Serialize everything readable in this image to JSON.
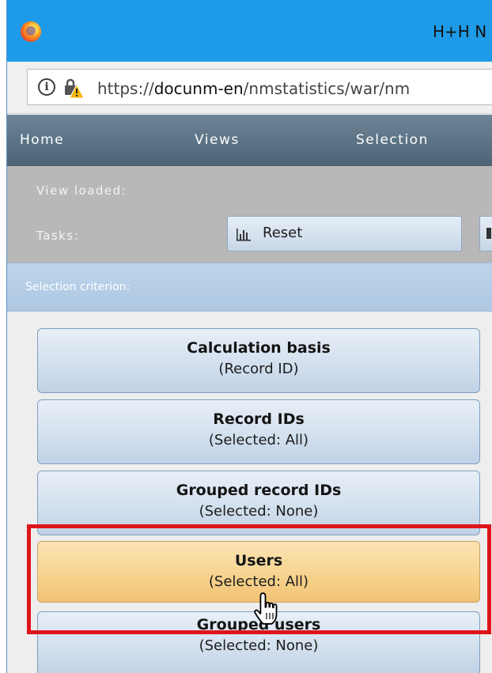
{
  "window": {
    "title": "H+H N"
  },
  "address_bar": {
    "url_prefix": "https://",
    "url_host": "docunm-en",
    "url_path": "/nmstatistics/war/nm"
  },
  "nav": {
    "items": [
      "Home",
      "Views",
      "Selection"
    ]
  },
  "task_panel": {
    "view_loaded_label": "View loaded:",
    "tasks_label": "Tasks:",
    "reset_label": "Reset"
  },
  "selection": {
    "header": "Selection criterion:",
    "criteria": [
      {
        "title": "Calculation basis",
        "subtitle": "(Record ID)",
        "active": false
      },
      {
        "title": "Record IDs",
        "subtitle": "(Selected: All)",
        "active": false
      },
      {
        "title": "Grouped record IDs",
        "subtitle": "(Selected: None)",
        "active": false
      },
      {
        "title": "Users",
        "subtitle": "(Selected: All)",
        "active": true
      },
      {
        "title": "Grouped users",
        "subtitle": "(Selected: None)",
        "active": false
      }
    ]
  },
  "colors": {
    "highlight": "#e0141b",
    "active_item": "#f7d28c",
    "nav_bar": "#5a7284",
    "title_bar": "#1e9be8"
  },
  "icons": {
    "browser": "firefox-icon",
    "info": "info-icon",
    "lock": "lock-warning-icon",
    "reset": "bar-chart-icon",
    "cursor": "hand-pointer-icon"
  }
}
